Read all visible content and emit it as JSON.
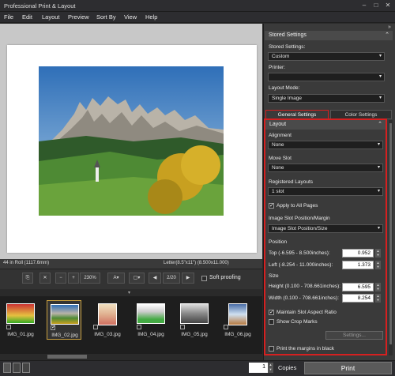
{
  "app": {
    "title": "Professional Print & Layout"
  },
  "menu": [
    "File",
    "Edit",
    "Layout",
    "Preview",
    "Sort By",
    "View",
    "Help"
  ],
  "status": {
    "roll": "44 in Roll (1117.6mm)",
    "paper": "Letter(8.5\"x11\") (8.500x11.000)"
  },
  "toolbar": {
    "zoom": "230%",
    "page": "2/20",
    "soft_proofing": "Soft proofing"
  },
  "thumbnails": [
    {
      "name": "IMG_01.jpg",
      "checked": false
    },
    {
      "name": "IMG_02.jpg",
      "checked": true
    },
    {
      "name": "IMG_03.jpg",
      "checked": false
    },
    {
      "name": "IMG_04.jpg",
      "checked": false
    },
    {
      "name": "IMG_05.jpg",
      "checked": false
    },
    {
      "name": "IMG_06.jpg",
      "checked": false
    }
  ],
  "panel": {
    "stored_settings_header": "Stored Settings",
    "stored_settings_label": "Stored Settings:",
    "stored_settings_value": "Custom",
    "printer_label": "Printer:",
    "printer_value": "",
    "layout_mode_label": "Layout Mode:",
    "layout_mode_value": "Single Image",
    "tab_general": "General Settings",
    "tab_color": "Color Settings",
    "layout_header": "Layout",
    "alignment_label": "Alignment",
    "alignment_value": "None",
    "move_slot_label": "Move Slot",
    "move_slot_value": "None",
    "registered_layouts_label": "Registered Layouts",
    "registered_layouts_value": "1 slot",
    "apply_all_pages": "Apply to All Pages",
    "slot_position_label": "Image Slot Position/Margin",
    "slot_position_value": "Image Slot Position/Size",
    "position_label": "Position",
    "top_label": "Top (-6.595 - 8.500inches):",
    "top_value": "0.952",
    "left_label": "Left (-8.254 - 11.000inches):",
    "left_value": "1.373",
    "size_label": "Size",
    "height_label": "Height (0.100 - 708.661inches):",
    "height_value": "6.595",
    "width_label": "Width (0.100 - 708.661inches):",
    "width_value": "8.254",
    "maintain_aspect": "Maintain Slot Aspect Ratio",
    "show_crop": "Show Crop Marks",
    "settings_button": "Settings...",
    "print_margins": "Print the margins in black"
  },
  "bottom": {
    "copies_value": "1",
    "copies_label": "Copies",
    "print_label": "Print"
  }
}
